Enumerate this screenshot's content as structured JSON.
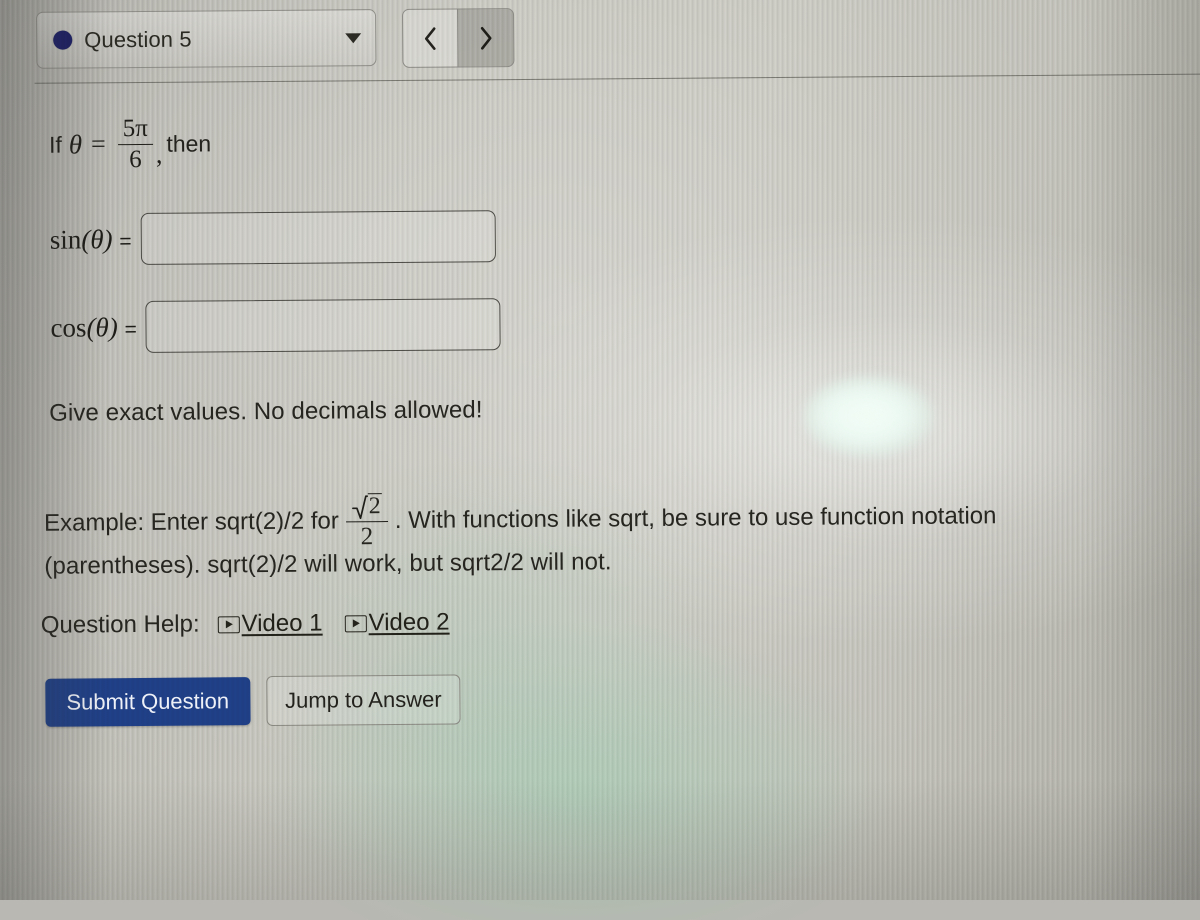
{
  "question_selector": {
    "label": "Question 5",
    "dot_color": "#1c1f63",
    "caret_icon": "chevron-down-icon",
    "prev_label": "‹",
    "next_label": "›"
  },
  "prompt": {
    "if_text": "If",
    "theta": "θ",
    "equals": "=",
    "fraction_numerator": "5π",
    "fraction_denominator": "6",
    "comma": ",",
    "then_text": "then"
  },
  "answers": [
    {
      "label_fn": "sin",
      "label_arg": "(θ)",
      "label_eq": "=",
      "value": "",
      "placeholder": ""
    },
    {
      "label_fn": "cos",
      "label_arg": "(θ)",
      "label_eq": "=",
      "value": "",
      "placeholder": ""
    }
  ],
  "notes": {
    "exact_values": "Give exact values. No decimals allowed!",
    "example_prefix": "Example: Enter sqrt(2)/2 for",
    "example_fraction_numerator": "2",
    "example_fraction_denominator": "2",
    "example_suffix": ". With functions like sqrt, be sure to use function notation",
    "example_line2": "(parentheses). sqrt(2)/2 will work, but sqrt2/2 will not."
  },
  "help": {
    "label": "Question Help:",
    "links": [
      {
        "text": "Video 1",
        "icon": "play-video-icon"
      },
      {
        "text": "Video 2",
        "icon": "play-video-icon"
      }
    ]
  },
  "buttons": {
    "submit": "Submit Question",
    "jump": "Jump to Answer",
    "submit_color": "#1f3f86"
  }
}
